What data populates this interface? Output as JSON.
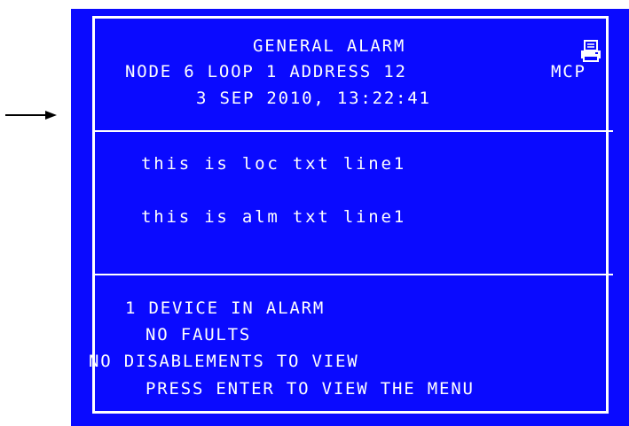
{
  "header": {
    "title": "GENERAL ALARM",
    "location": "NODE 6 LOOP 1 ADDRESS 12",
    "device_type": "MCP",
    "datetime": "3 SEP 2010, 13:22:41"
  },
  "alarm": {
    "location_text": "this is loc txt line1",
    "alarm_text": "this is alm txt line1"
  },
  "status": {
    "devices_in_alarm": "1 DEVICE IN ALARM",
    "faults": "NO FAULTS",
    "disablements": "NO DISABLEMENTS TO VIEW",
    "menu_prompt": "PRESS ENTER TO VIEW THE MENU"
  },
  "icons": {
    "print": "print-icon",
    "pointer": "arrow-right-icon"
  },
  "colors": {
    "panel_background": "#0a0aff",
    "foreground": "#ffffff"
  }
}
